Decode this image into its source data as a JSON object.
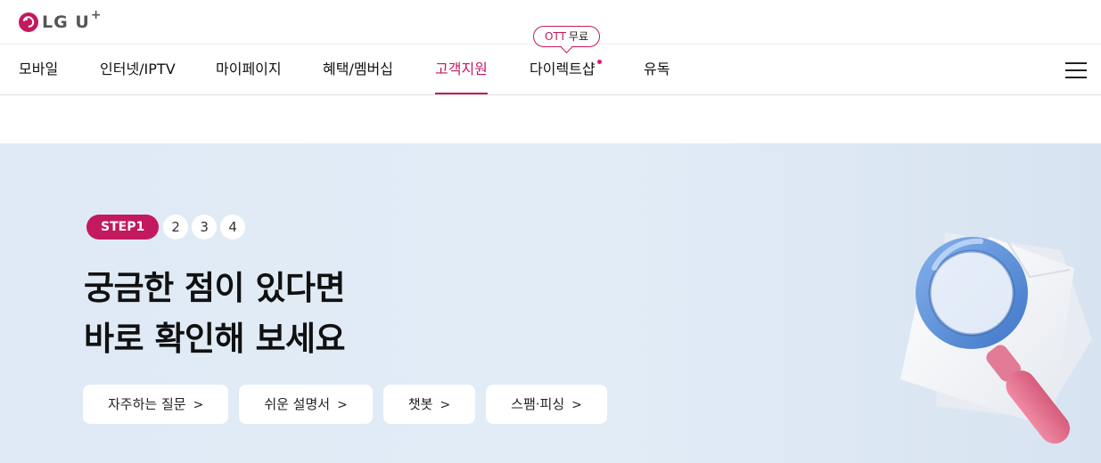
{
  "brand": {
    "logo_text": "LG U",
    "logo_plus": "+"
  },
  "nav": {
    "items": [
      {
        "label": "모바일"
      },
      {
        "label": "인터넷/IPTV"
      },
      {
        "label": "마이페이지"
      },
      {
        "label": "혜택/멤버십"
      },
      {
        "label": "고객지원",
        "active": true
      },
      {
        "label": "다이렉트샵",
        "new_dot": true
      },
      {
        "label": "유독"
      }
    ],
    "promo_bubble": {
      "ott": "OTT",
      "free": "무료"
    },
    "menu_icon": "hamburger-menu-icon"
  },
  "hero": {
    "steps": {
      "active": "STEP1",
      "others": [
        "2",
        "3",
        "4"
      ]
    },
    "headline": {
      "line1": "궁금한 점이 있다면",
      "line2": "바로 확인해 보세요"
    },
    "quick_links": [
      {
        "label": "자주하는 질문"
      },
      {
        "label": "쉬운 설명서"
      },
      {
        "label": "챗봇"
      },
      {
        "label": "스팸·피싱"
      }
    ],
    "arrow": ">",
    "illustration_icon": "magnifier-document-icon"
  },
  "colors": {
    "accent": "#c3195e",
    "hero_bg": "#e0ebf6",
    "white": "#ffffff"
  }
}
